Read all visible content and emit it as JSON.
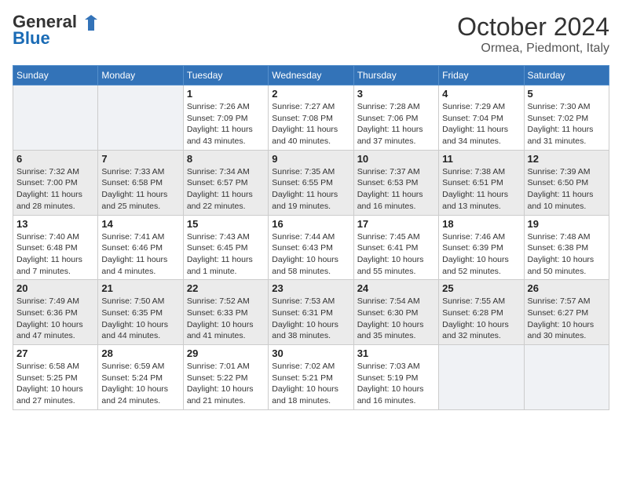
{
  "header": {
    "logo_line1": "General",
    "logo_line2": "Blue",
    "title": "October 2024",
    "subtitle": "Ormea, Piedmont, Italy"
  },
  "calendar": {
    "days_of_week": [
      "Sunday",
      "Monday",
      "Tuesday",
      "Wednesday",
      "Thursday",
      "Friday",
      "Saturday"
    ],
    "weeks": [
      [
        {
          "day": "",
          "sunrise": "",
          "sunset": "",
          "daylight": ""
        },
        {
          "day": "",
          "sunrise": "",
          "sunset": "",
          "daylight": ""
        },
        {
          "day": "1",
          "sunrise": "Sunrise: 7:26 AM",
          "sunset": "Sunset: 7:09 PM",
          "daylight": "Daylight: 11 hours and 43 minutes."
        },
        {
          "day": "2",
          "sunrise": "Sunrise: 7:27 AM",
          "sunset": "Sunset: 7:08 PM",
          "daylight": "Daylight: 11 hours and 40 minutes."
        },
        {
          "day": "3",
          "sunrise": "Sunrise: 7:28 AM",
          "sunset": "Sunset: 7:06 PM",
          "daylight": "Daylight: 11 hours and 37 minutes."
        },
        {
          "day": "4",
          "sunrise": "Sunrise: 7:29 AM",
          "sunset": "Sunset: 7:04 PM",
          "daylight": "Daylight: 11 hours and 34 minutes."
        },
        {
          "day": "5",
          "sunrise": "Sunrise: 7:30 AM",
          "sunset": "Sunset: 7:02 PM",
          "daylight": "Daylight: 11 hours and 31 minutes."
        }
      ],
      [
        {
          "day": "6",
          "sunrise": "Sunrise: 7:32 AM",
          "sunset": "Sunset: 7:00 PM",
          "daylight": "Daylight: 11 hours and 28 minutes."
        },
        {
          "day": "7",
          "sunrise": "Sunrise: 7:33 AM",
          "sunset": "Sunset: 6:58 PM",
          "daylight": "Daylight: 11 hours and 25 minutes."
        },
        {
          "day": "8",
          "sunrise": "Sunrise: 7:34 AM",
          "sunset": "Sunset: 6:57 PM",
          "daylight": "Daylight: 11 hours and 22 minutes."
        },
        {
          "day": "9",
          "sunrise": "Sunrise: 7:35 AM",
          "sunset": "Sunset: 6:55 PM",
          "daylight": "Daylight: 11 hours and 19 minutes."
        },
        {
          "day": "10",
          "sunrise": "Sunrise: 7:37 AM",
          "sunset": "Sunset: 6:53 PM",
          "daylight": "Daylight: 11 hours and 16 minutes."
        },
        {
          "day": "11",
          "sunrise": "Sunrise: 7:38 AM",
          "sunset": "Sunset: 6:51 PM",
          "daylight": "Daylight: 11 hours and 13 minutes."
        },
        {
          "day": "12",
          "sunrise": "Sunrise: 7:39 AM",
          "sunset": "Sunset: 6:50 PM",
          "daylight": "Daylight: 11 hours and 10 minutes."
        }
      ],
      [
        {
          "day": "13",
          "sunrise": "Sunrise: 7:40 AM",
          "sunset": "Sunset: 6:48 PM",
          "daylight": "Daylight: 11 hours and 7 minutes."
        },
        {
          "day": "14",
          "sunrise": "Sunrise: 7:41 AM",
          "sunset": "Sunset: 6:46 PM",
          "daylight": "Daylight: 11 hours and 4 minutes."
        },
        {
          "day": "15",
          "sunrise": "Sunrise: 7:43 AM",
          "sunset": "Sunset: 6:45 PM",
          "daylight": "Daylight: 11 hours and 1 minute."
        },
        {
          "day": "16",
          "sunrise": "Sunrise: 7:44 AM",
          "sunset": "Sunset: 6:43 PM",
          "daylight": "Daylight: 10 hours and 58 minutes."
        },
        {
          "day": "17",
          "sunrise": "Sunrise: 7:45 AM",
          "sunset": "Sunset: 6:41 PM",
          "daylight": "Daylight: 10 hours and 55 minutes."
        },
        {
          "day": "18",
          "sunrise": "Sunrise: 7:46 AM",
          "sunset": "Sunset: 6:39 PM",
          "daylight": "Daylight: 10 hours and 52 minutes."
        },
        {
          "day": "19",
          "sunrise": "Sunrise: 7:48 AM",
          "sunset": "Sunset: 6:38 PM",
          "daylight": "Daylight: 10 hours and 50 minutes."
        }
      ],
      [
        {
          "day": "20",
          "sunrise": "Sunrise: 7:49 AM",
          "sunset": "Sunset: 6:36 PM",
          "daylight": "Daylight: 10 hours and 47 minutes."
        },
        {
          "day": "21",
          "sunrise": "Sunrise: 7:50 AM",
          "sunset": "Sunset: 6:35 PM",
          "daylight": "Daylight: 10 hours and 44 minutes."
        },
        {
          "day": "22",
          "sunrise": "Sunrise: 7:52 AM",
          "sunset": "Sunset: 6:33 PM",
          "daylight": "Daylight: 10 hours and 41 minutes."
        },
        {
          "day": "23",
          "sunrise": "Sunrise: 7:53 AM",
          "sunset": "Sunset: 6:31 PM",
          "daylight": "Daylight: 10 hours and 38 minutes."
        },
        {
          "day": "24",
          "sunrise": "Sunrise: 7:54 AM",
          "sunset": "Sunset: 6:30 PM",
          "daylight": "Daylight: 10 hours and 35 minutes."
        },
        {
          "day": "25",
          "sunrise": "Sunrise: 7:55 AM",
          "sunset": "Sunset: 6:28 PM",
          "daylight": "Daylight: 10 hours and 32 minutes."
        },
        {
          "day": "26",
          "sunrise": "Sunrise: 7:57 AM",
          "sunset": "Sunset: 6:27 PM",
          "daylight": "Daylight: 10 hours and 30 minutes."
        }
      ],
      [
        {
          "day": "27",
          "sunrise": "Sunrise: 6:58 AM",
          "sunset": "Sunset: 5:25 PM",
          "daylight": "Daylight: 10 hours and 27 minutes."
        },
        {
          "day": "28",
          "sunrise": "Sunrise: 6:59 AM",
          "sunset": "Sunset: 5:24 PM",
          "daylight": "Daylight: 10 hours and 24 minutes."
        },
        {
          "day": "29",
          "sunrise": "Sunrise: 7:01 AM",
          "sunset": "Sunset: 5:22 PM",
          "daylight": "Daylight: 10 hours and 21 minutes."
        },
        {
          "day": "30",
          "sunrise": "Sunrise: 7:02 AM",
          "sunset": "Sunset: 5:21 PM",
          "daylight": "Daylight: 10 hours and 18 minutes."
        },
        {
          "day": "31",
          "sunrise": "Sunrise: 7:03 AM",
          "sunset": "Sunset: 5:19 PM",
          "daylight": "Daylight: 10 hours and 16 minutes."
        },
        {
          "day": "",
          "sunrise": "",
          "sunset": "",
          "daylight": ""
        },
        {
          "day": "",
          "sunrise": "",
          "sunset": "",
          "daylight": ""
        }
      ]
    ]
  }
}
